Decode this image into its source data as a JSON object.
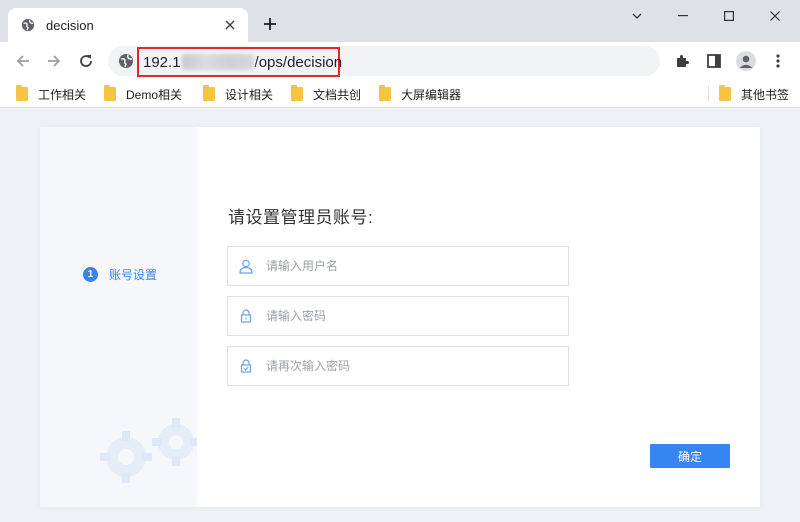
{
  "browser": {
    "tab": {
      "title": "decision",
      "favicon": "globe-icon"
    },
    "url": {
      "prefix": "192.1",
      "suffix": "/ops/decision"
    },
    "bookmarks": [
      {
        "label": "工作相关"
      },
      {
        "label": "Demo相关"
      },
      {
        "label": "设计相关"
      },
      {
        "label": "文档共创"
      },
      {
        "label": "大屏编辑器"
      }
    ],
    "other_bookmarks": "其他书签"
  },
  "wizard": {
    "step_number": "1",
    "step_label": "账号设置",
    "title": "请设置管理员账号:",
    "fields": {
      "username_placeholder": "请输入用户名",
      "password_placeholder": "请输入密码",
      "confirm_placeholder": "请再次输入密码"
    },
    "submit_label": "确定"
  },
  "colors": {
    "accent": "#3685f2",
    "highlight_border": "#e5262b",
    "folder": "#f6c343"
  }
}
